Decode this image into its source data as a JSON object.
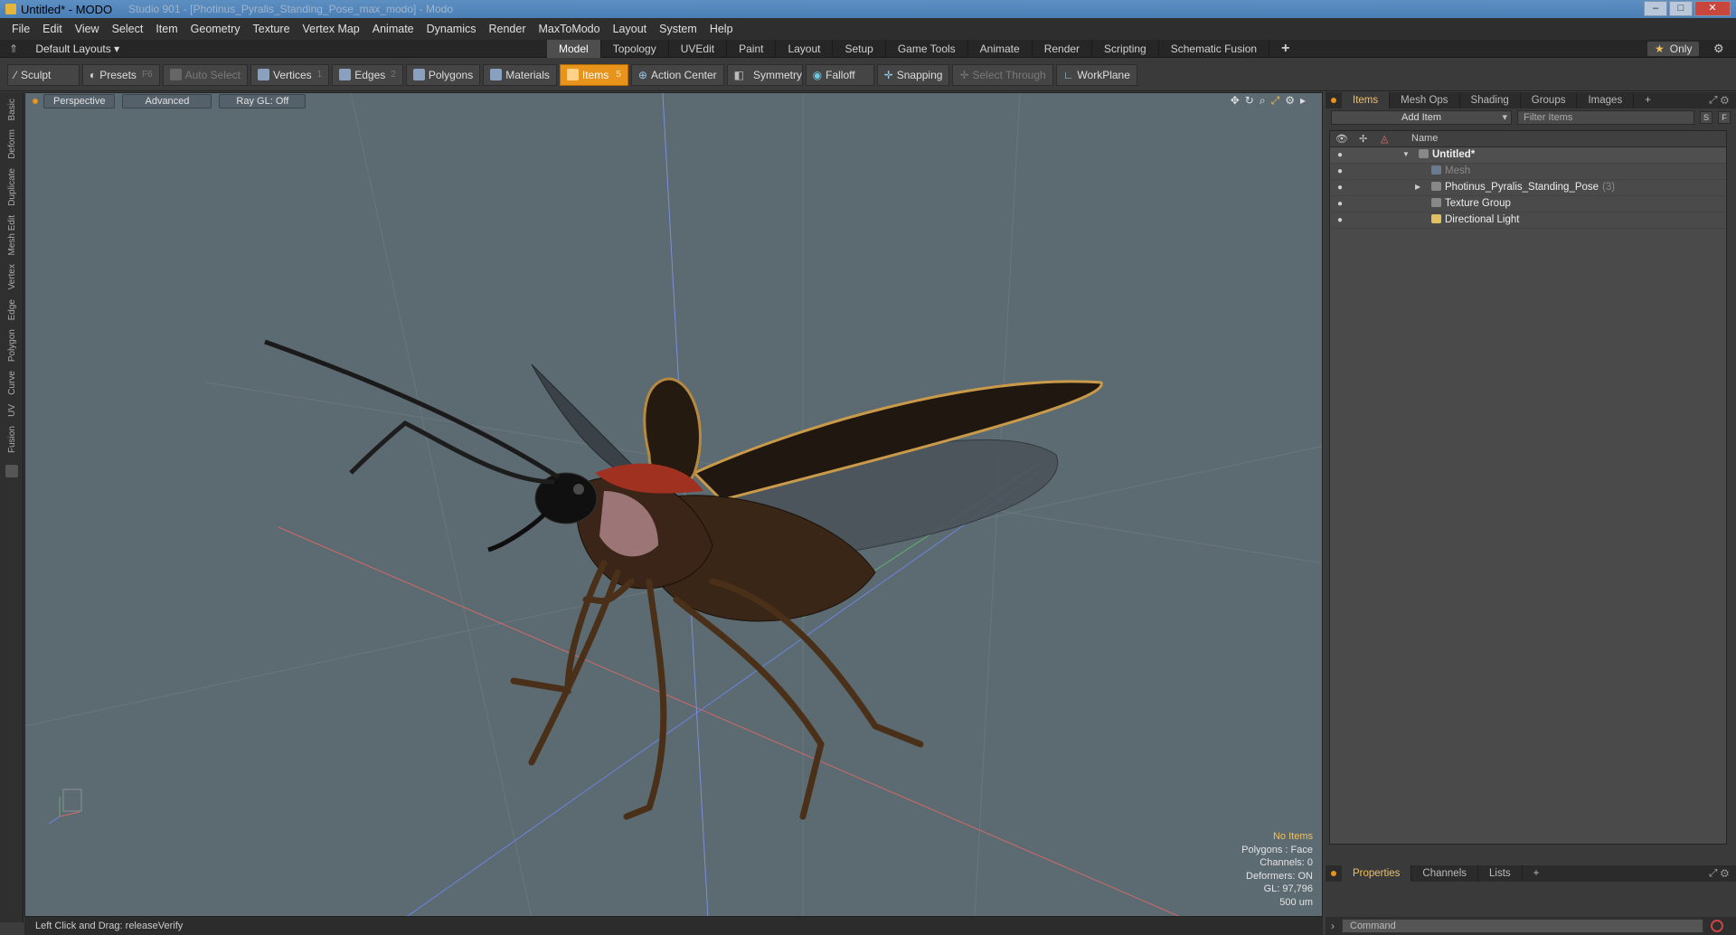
{
  "window": {
    "title": "Untitled* - MODO",
    "ghost_title": "Studio 901 - [Photinus_Pyralis_Standing_Pose_max_modo] - Modo",
    "min_label": "–",
    "max_label": "□",
    "close_label": "✕"
  },
  "menu": [
    "File",
    "Edit",
    "View",
    "Select",
    "Item",
    "Geometry",
    "Texture",
    "Vertex Map",
    "Animate",
    "Dynamics",
    "Render",
    "MaxToModo",
    "Layout",
    "System",
    "Help"
  ],
  "layout_selector": "Default Layouts ▾",
  "layout_tabs": [
    {
      "label": "Model",
      "active": true
    },
    {
      "label": "Topology",
      "active": false
    },
    {
      "label": "UVEdit",
      "active": false
    },
    {
      "label": "Paint",
      "active": false
    },
    {
      "label": "Layout",
      "active": false
    },
    {
      "label": "Setup",
      "active": false
    },
    {
      "label": "Game Tools",
      "active": false
    },
    {
      "label": "Animate",
      "active": false
    },
    {
      "label": "Render",
      "active": false
    },
    {
      "label": "Scripting",
      "active": false
    },
    {
      "label": "Schematic Fusion",
      "active": false
    }
  ],
  "layout_plus": "+",
  "only_star": "★",
  "only_label": "Only",
  "toolbar": {
    "sculpt": "Sculpt",
    "presets": "Presets",
    "presets_key": "F6",
    "auto_select": "Auto Select",
    "vertices": "Vertices",
    "vertices_key": "1",
    "edges": "Edges",
    "edges_key": "2",
    "polygons": "Polygons",
    "materials": "Materials",
    "items": "Items",
    "items_key": "5",
    "action_center": "Action Center",
    "symmetry": "Symmetry",
    "falloff": "Falloff",
    "snapping": "Snapping",
    "select_through": "Select Through",
    "workplane": "WorkPlane"
  },
  "left_tabs": [
    "Basic",
    "Deform",
    "Duplicate",
    "Mesh Edit",
    "Vertex",
    "Edge",
    "Polygon",
    "Curve",
    "UV",
    "Fusion"
  ],
  "viewport": {
    "view_mode": "Perspective",
    "shading": "Advanced",
    "raygl": "Ray GL: Off",
    "info": {
      "no_items": "No Items",
      "polygons": "Polygons : Face",
      "channels": "Channels: 0",
      "deformers": "Deformers: ON",
      "gl": "GL: 97,796",
      "scale": "500 um"
    }
  },
  "status": "Left Click and Drag:   releaseVerify",
  "items_panel": {
    "tabs": [
      {
        "label": "Items",
        "active": true
      },
      {
        "label": "Mesh Ops",
        "active": false
      },
      {
        "label": "Shading",
        "active": false
      },
      {
        "label": "Groups",
        "active": false
      },
      {
        "label": "Images",
        "active": false
      },
      {
        "label": "+",
        "active": false
      }
    ],
    "add_item": "Add Item",
    "filter_placeholder": "Filter Items",
    "btn_s": "S",
    "btn_f": "F",
    "name_header": "Name",
    "rows": [
      {
        "label": "Untitled*",
        "count": ""
      },
      {
        "label": "Mesh",
        "count": ""
      },
      {
        "label": "Photinus_Pyralis_Standing_Pose",
        "count": "(3)"
      },
      {
        "label": "Texture Group",
        "count": ""
      },
      {
        "label": "Directional Light",
        "count": ""
      }
    ]
  },
  "props_panel": {
    "tabs": [
      {
        "label": "Properties",
        "active": true
      },
      {
        "label": "Channels",
        "active": false
      },
      {
        "label": "Lists",
        "active": false
      },
      {
        "label": "+",
        "active": false
      }
    ]
  },
  "command_placeholder": "Command",
  "colors": {
    "accent": "#e8941c",
    "highlight": "#f0c060",
    "viewport_bg": "#5c6a72"
  }
}
